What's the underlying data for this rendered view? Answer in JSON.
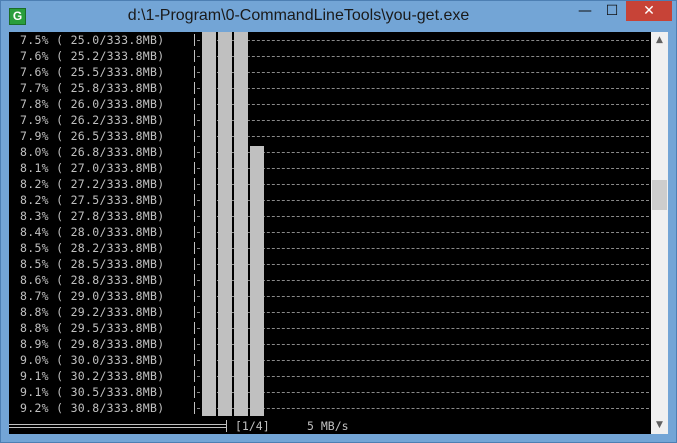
{
  "window": {
    "title": "d:\\1-Program\\0-CommandLineTools\\you-get.exe",
    "icon_glyph": "G",
    "icon_name": "you-get-app-icon",
    "minimize_glyph": "—",
    "maximize_glyph": "☐",
    "close_glyph": "✕"
  },
  "console": {
    "background": "#000000",
    "text_color": "#c0c0c0",
    "progress_lines": [
      "7.5% ( 25.0/333.8MB)",
      "7.6% ( 25.2/333.8MB)",
      "7.6% ( 25.5/333.8MB)",
      "7.7% ( 25.8/333.8MB)",
      "7.8% ( 26.0/333.8MB)",
      "7.9% ( 26.2/333.8MB)",
      "7.9% ( 26.5/333.8MB)",
      "8.0% ( 26.8/333.8MB)",
      "8.1% ( 27.0/333.8MB)",
      "8.2% ( 27.2/333.8MB)",
      "8.2% ( 27.5/333.8MB)",
      "8.3% ( 27.8/333.8MB)",
      "8.4% ( 28.0/333.8MB)",
      "8.5% ( 28.2/333.8MB)",
      "8.5% ( 28.5/333.8MB)",
      "8.6% ( 28.8/333.8MB)",
      "8.7% ( 29.0/333.8MB)",
      "8.8% ( 29.2/333.8MB)",
      "8.8% ( 29.5/333.8MB)",
      "8.9% ( 29.8/333.8MB)",
      "9.0% ( 30.0/333.8MB)",
      "9.1% ( 30.2/333.8MB)",
      "9.1% ( 30.5/333.8MB)",
      "9.2% ( 30.8/333.8MB)"
    ],
    "status": {
      "file_counter": "[1/4]",
      "speed": "5 MB/s"
    }
  }
}
